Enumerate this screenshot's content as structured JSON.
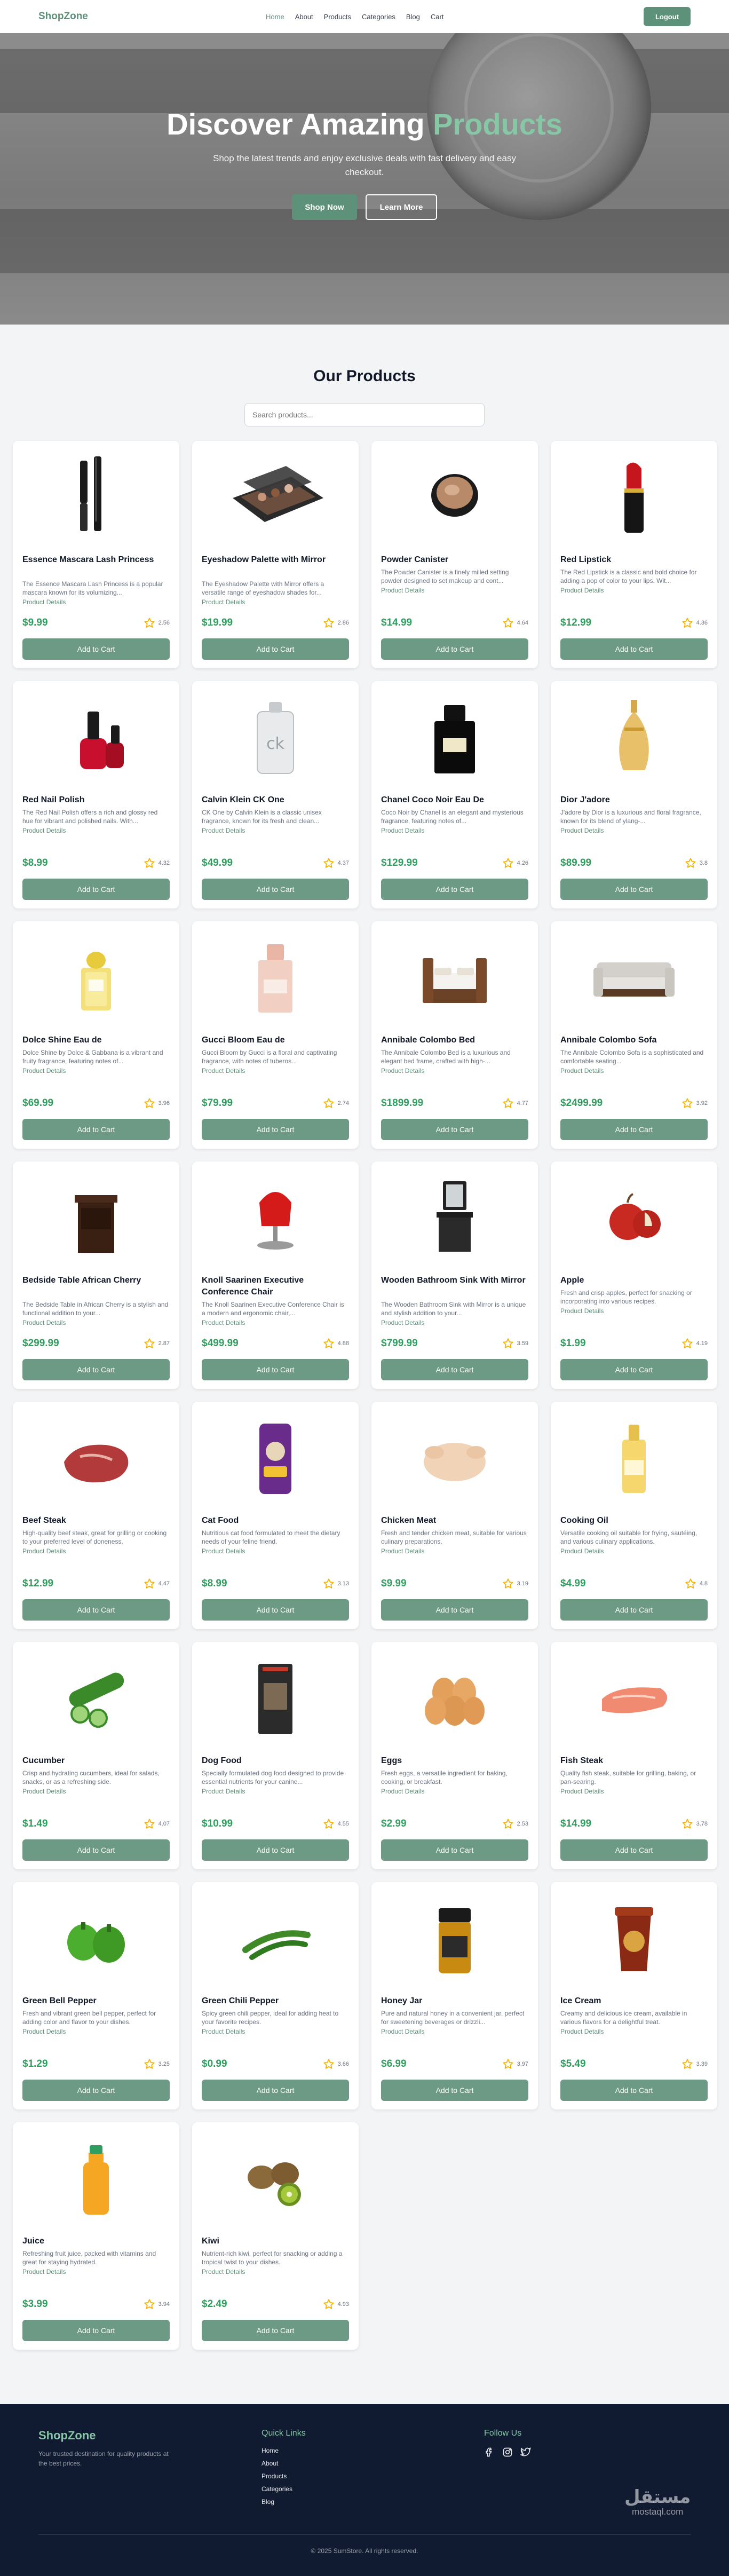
{
  "nav": {
    "logo": "ShopZone",
    "links": [
      "Home",
      "About",
      "Products",
      "Categories",
      "Blog",
      "Cart"
    ],
    "logout": "Logout"
  },
  "hero": {
    "title_main": "Discover Amazing ",
    "title_accent": "Products",
    "subtitle": "Shop the latest trends and enjoy exclusive deals with fast delivery and easy checkout.",
    "shop_now": "Shop Now",
    "learn_more": "Learn More"
  },
  "products_section": {
    "title": "Our Products",
    "search_placeholder": "Search products..."
  },
  "products": [
    {
      "name": "Essence Mascara Lash Princess",
      "desc": "The Essence Mascara Lash Princess is a popular mascara known for its volumizing...",
      "details": "Product Details",
      "price": "$9.99",
      "rating": "2.56",
      "icon": "mascara-icon"
    },
    {
      "name": "Eyeshadow Palette with Mirror",
      "desc": "The Eyeshadow Palette with Mirror offers a versatile range of eyeshadow shades for...",
      "details": "Product Details",
      "price": "$19.99",
      "rating": "2.86",
      "icon": "eyeshadow-palette-icon"
    },
    {
      "name": "Powder Canister",
      "desc": "The Powder Canister is a finely milled setting powder designed to set makeup and cont...",
      "details": "Product Details",
      "price": "$14.99",
      "rating": "4.64",
      "icon": "powder-canister-icon"
    },
    {
      "name": "Red Lipstick",
      "desc": "The Red Lipstick is a classic and bold choice for adding a pop of color to your lips. Wit...",
      "details": "Product Details",
      "price": "$12.99",
      "rating": "4.36",
      "icon": "lipstick-icon"
    },
    {
      "name": "Red Nail Polish",
      "desc": "The Red Nail Polish offers a rich and glossy red hue for vibrant and polished nails. With...",
      "details": "Product Details",
      "price": "$8.99",
      "rating": "4.32",
      "icon": "nail-polish-icon"
    },
    {
      "name": "Calvin Klein CK One",
      "desc": "CK One by Calvin Klein is a classic unisex fragrance, known for its fresh and clean...",
      "details": "Product Details",
      "price": "$49.99",
      "rating": "4.37",
      "icon": "ck-one-bottle-icon"
    },
    {
      "name": "Chanel Coco Noir Eau De",
      "desc": "Coco Noir by Chanel is an elegant and mysterious fragrance, featuring notes of...",
      "details": "Product Details",
      "price": "$129.99",
      "rating": "4.26",
      "icon": "chanel-bottle-icon"
    },
    {
      "name": "Dior J'adore",
      "desc": "J'adore by Dior is a luxurious and floral fragrance, known for its blend of ylang-...",
      "details": "Product Details",
      "price": "$89.99",
      "rating": "3.8",
      "icon": "dior-bottle-icon"
    },
    {
      "name": "Dolce Shine Eau de",
      "desc": "Dolce Shine by Dolce & Gabbana is a vibrant and fruity fragrance, featuring notes of...",
      "details": "Product Details",
      "price": "$69.99",
      "rating": "3.96",
      "icon": "dolce-bottle-icon"
    },
    {
      "name": "Gucci Bloom Eau de",
      "desc": "Gucci Bloom by Gucci is a floral and captivating fragrance, with notes of tuberos...",
      "details": "Product Details",
      "price": "$79.99",
      "rating": "2.74",
      "icon": "gucci-bottle-icon"
    },
    {
      "name": "Annibale Colombo Bed",
      "desc": "The Annibale Colombo Bed is a luxurious and elegant bed frame, crafted with high-...",
      "details": "Product Details",
      "price": "$1899.99",
      "rating": "4.77",
      "icon": "bed-icon"
    },
    {
      "name": "Annibale Colombo Sofa",
      "desc": "The Annibale Colombo Sofa is a sophisticated and comfortable seating...",
      "details": "Product Details",
      "price": "$2499.99",
      "rating": "3.92",
      "icon": "sofa-icon"
    },
    {
      "name": "Bedside Table African Cherry",
      "desc": "The Bedside Table in African Cherry is a stylish and functional addition to your...",
      "details": "Product Details",
      "price": "$299.99",
      "rating": "2.87",
      "icon": "bedside-table-icon"
    },
    {
      "name": "Knoll Saarinen Executive Conference Chair",
      "desc": "The Knoll Saarinen Executive Conference Chair is a modern and ergonomic chair,...",
      "details": "Product Details",
      "price": "$499.99",
      "rating": "4.88",
      "icon": "office-chair-icon"
    },
    {
      "name": "Wooden Bathroom Sink With Mirror",
      "desc": "The Wooden Bathroom Sink with Mirror is a unique and stylish addition to your...",
      "details": "Product Details",
      "price": "$799.99",
      "rating": "3.59",
      "icon": "bathroom-sink-icon"
    },
    {
      "name": "Apple",
      "desc": "Fresh and crisp apples, perfect for snacking or incorporating into various recipes.",
      "details": "Product Details",
      "price": "$1.99",
      "rating": "4.19",
      "icon": "apple-icon"
    },
    {
      "name": "Beef Steak",
      "desc": "High-quality beef steak, great for grilling or cooking to your preferred level of doneness.",
      "details": "Product Details",
      "price": "$12.99",
      "rating": "4.47",
      "icon": "beef-steak-icon"
    },
    {
      "name": "Cat Food",
      "desc": "Nutritious cat food formulated to meet the dietary needs of your feline friend.",
      "details": "Product Details",
      "price": "$8.99",
      "rating": "3.13",
      "icon": "cat-food-icon"
    },
    {
      "name": "Chicken Meat",
      "desc": "Fresh and tender chicken meat, suitable for various culinary preparations.",
      "details": "Product Details",
      "price": "$9.99",
      "rating": "3.19",
      "icon": "chicken-icon"
    },
    {
      "name": "Cooking Oil",
      "desc": "Versatile cooking oil suitable for frying, sautéing, and various culinary applications.",
      "details": "Product Details",
      "price": "$4.99",
      "rating": "4.8",
      "icon": "cooking-oil-icon"
    },
    {
      "name": "Cucumber",
      "desc": "Crisp and hydrating cucumbers, ideal for salads, snacks, or as a refreshing side.",
      "details": "Product Details",
      "price": "$1.49",
      "rating": "4.07",
      "icon": "cucumber-icon"
    },
    {
      "name": "Dog Food",
      "desc": "Specially formulated dog food designed to provide essential nutrients for your canine...",
      "details": "Product Details",
      "price": "$10.99",
      "rating": "4.55",
      "icon": "dog-food-icon"
    },
    {
      "name": "Eggs",
      "desc": "Fresh eggs, a versatile ingredient for baking, cooking, or breakfast.",
      "details": "Product Details",
      "price": "$2.99",
      "rating": "2.53",
      "icon": "eggs-icon"
    },
    {
      "name": "Fish Steak",
      "desc": "Quality fish steak, suitable for grilling, baking, or pan-searing.",
      "details": "Product Details",
      "price": "$14.99",
      "rating": "3.78",
      "icon": "fish-steak-icon"
    },
    {
      "name": "Green Bell Pepper",
      "desc": "Fresh and vibrant green bell pepper, perfect for adding color and flavor to your dishes.",
      "details": "Product Details",
      "price": "$1.29",
      "rating": "3.25",
      "icon": "bell-pepper-icon"
    },
    {
      "name": "Green Chili Pepper",
      "desc": "Spicy green chili pepper, ideal for adding heat to your favorite recipes.",
      "details": "Product Details",
      "price": "$0.99",
      "rating": "3.66",
      "icon": "chili-pepper-icon"
    },
    {
      "name": "Honey Jar",
      "desc": "Pure and natural honey in a convenient jar, perfect for sweetening beverages or drizzli...",
      "details": "Product Details",
      "price": "$6.99",
      "rating": "3.97",
      "icon": "honey-jar-icon"
    },
    {
      "name": "Ice Cream",
      "desc": "Creamy and delicious ice cream, available in various flavors for a delightful treat.",
      "details": "Product Details",
      "price": "$5.49",
      "rating": "3.39",
      "icon": "ice-cream-icon"
    },
    {
      "name": "Juice",
      "desc": "Refreshing fruit juice, packed with vitamins and great for staying hydrated.",
      "details": "Product Details",
      "price": "$3.99",
      "rating": "3.94",
      "icon": "juice-bottle-icon"
    },
    {
      "name": "Kiwi",
      "desc": "Nutrient-rich kiwi, perfect for snacking or adding a tropical twist to your dishes.",
      "details": "Product Details",
      "price": "$2.49",
      "rating": "4.93",
      "icon": "kiwi-icon"
    }
  ],
  "cart_label": "Add to Cart",
  "footer": {
    "brand": "ShopZone",
    "tagline": "Your trusted destination for quality products at the best prices.",
    "quick_links_title": "Quick Links",
    "quick_links": [
      "Home",
      "About",
      "Products",
      "Categories",
      "Blog"
    ],
    "follow_title": "Follow Us",
    "social": [
      "facebook-icon",
      "instagram-icon",
      "twitter-icon"
    ],
    "copyright": "© 2025 SumStore. All rights reserved.",
    "watermark_ar": "مستقل",
    "watermark_en": "mostaql.com"
  },
  "colors": {
    "accent": "#5e917a",
    "price": "#2f9e5e",
    "star": "#f5b301",
    "footer_bg": "#101a30"
  }
}
